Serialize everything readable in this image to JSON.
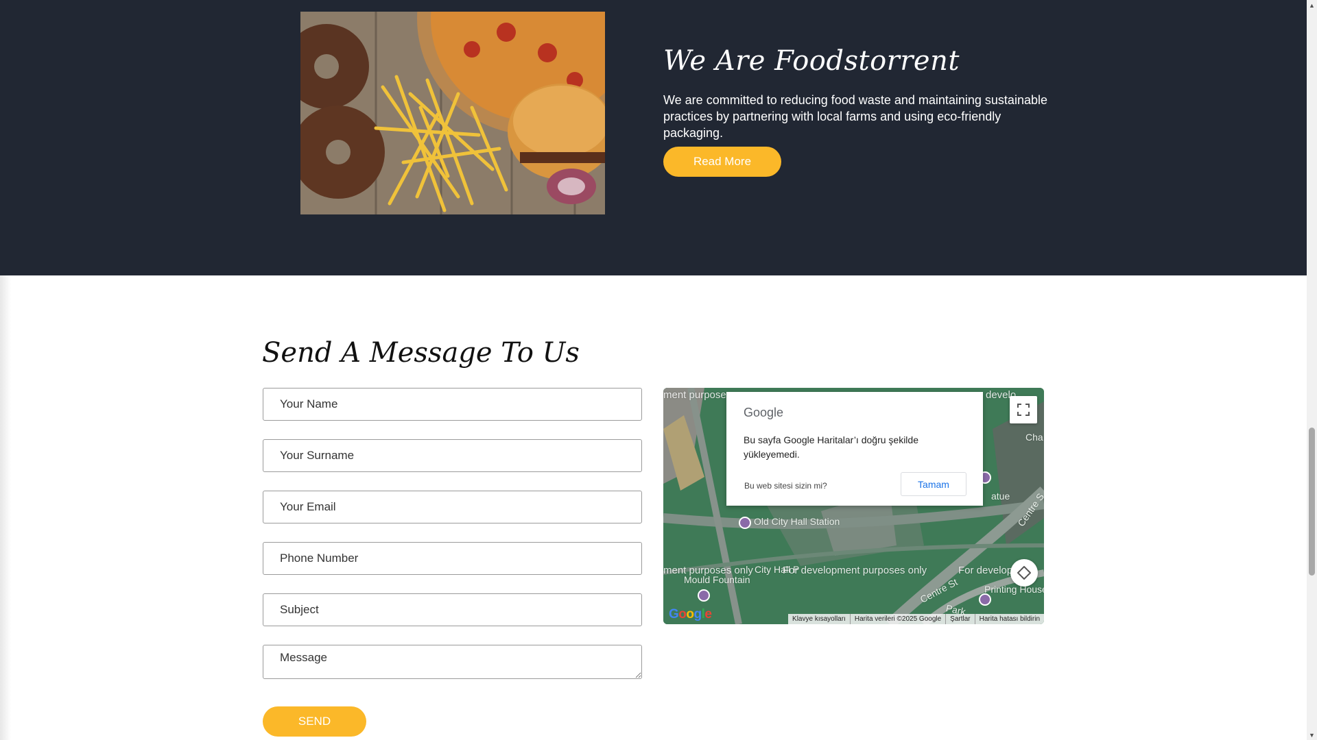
{
  "about": {
    "title": "We Are Foodstorrent",
    "text": "We are committed to reducing food waste and maintaining sustainable practices by partnering with local farms and using eco-friendly packaging.",
    "button_label": "Read More",
    "image_icon": "fast-food-photo"
  },
  "contact": {
    "title": "Send A Message To Us",
    "fields": {
      "name_placeholder": "Your Name",
      "surname_placeholder": "Your Surname",
      "email_placeholder": "Your Email",
      "phone_placeholder": "Phone Number",
      "subject_placeholder": "Subject",
      "message_placeholder": "Message"
    },
    "send_label": "SEND"
  },
  "map": {
    "dialog": {
      "brand": "Google",
      "message": "Bu sayfa Google Haritalar’ı doğru şekilde yükleyemedi.",
      "link": "Bu web sitesi sizin mi?",
      "ok_label": "Tamam"
    },
    "labels": {
      "station": "Old City Hall Station",
      "dev_left": "ment purposes only",
      "dev_center": "For development purposes only",
      "dev_right": "For develop",
      "dev_top_left": "ment purpose",
      "dev_top_right": "develo",
      "mould": "Mould Fountain",
      "city_hall": "City Hall P",
      "statue": "atue",
      "printing": "Printing House",
      "centre_st": "Centre St",
      "centre_right": "Centre S",
      "park": "Park",
      "cha": "Cha"
    },
    "logo": "Google",
    "footer": {
      "shortcuts": "Klavye kısayolları",
      "data": "Harita verileri ©2025 Google",
      "terms": "Şartlar",
      "report": "Harita hatası bildirin"
    }
  },
  "colors": {
    "dark_bg": "#212733",
    "accent": "#fbb829",
    "map_green": "#3f7a57"
  }
}
